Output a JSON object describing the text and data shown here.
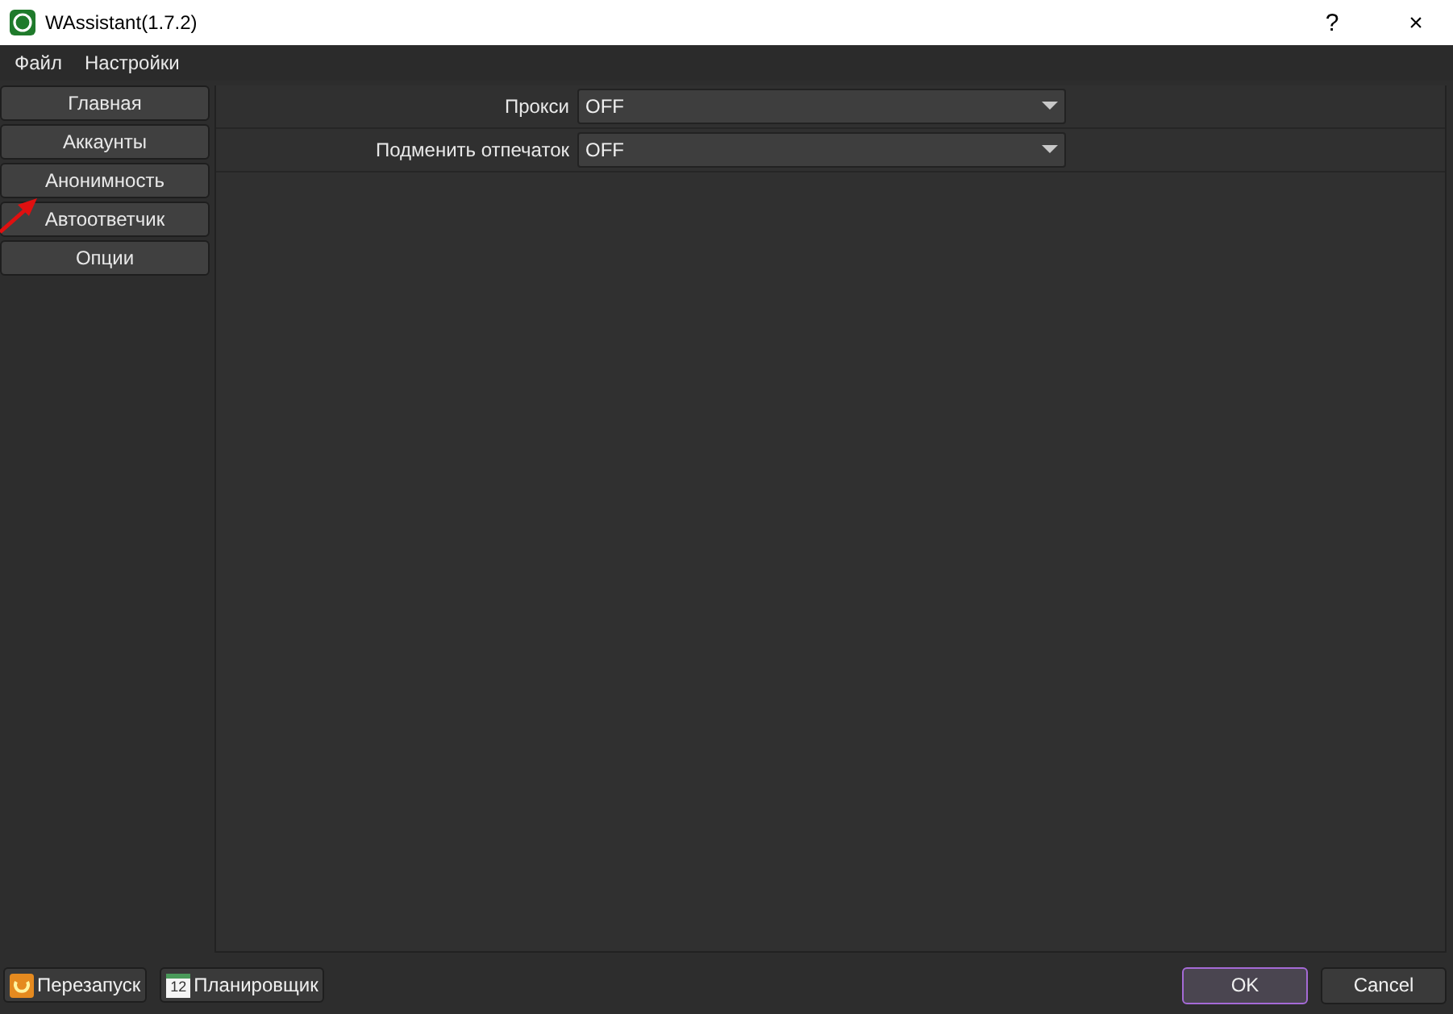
{
  "window": {
    "title": "WAssistant(1.7.2)",
    "help": "?",
    "close": "×"
  },
  "menu": [
    "Файл",
    "Настройки"
  ],
  "sidebar": {
    "items": [
      "Главная",
      "Аккаунты",
      "Анонимность",
      "Автоответчик",
      "Опции"
    ]
  },
  "settings": [
    {
      "label": "Прокси",
      "value": "OFF"
    },
    {
      "label": "Подменить отпечаток",
      "value": "OFF"
    }
  ],
  "bottom": {
    "restart": "Перезапуск",
    "scheduler": "Планировщик",
    "scheduler_icon_day": "12",
    "ok": "OK",
    "cancel": "Cancel"
  }
}
